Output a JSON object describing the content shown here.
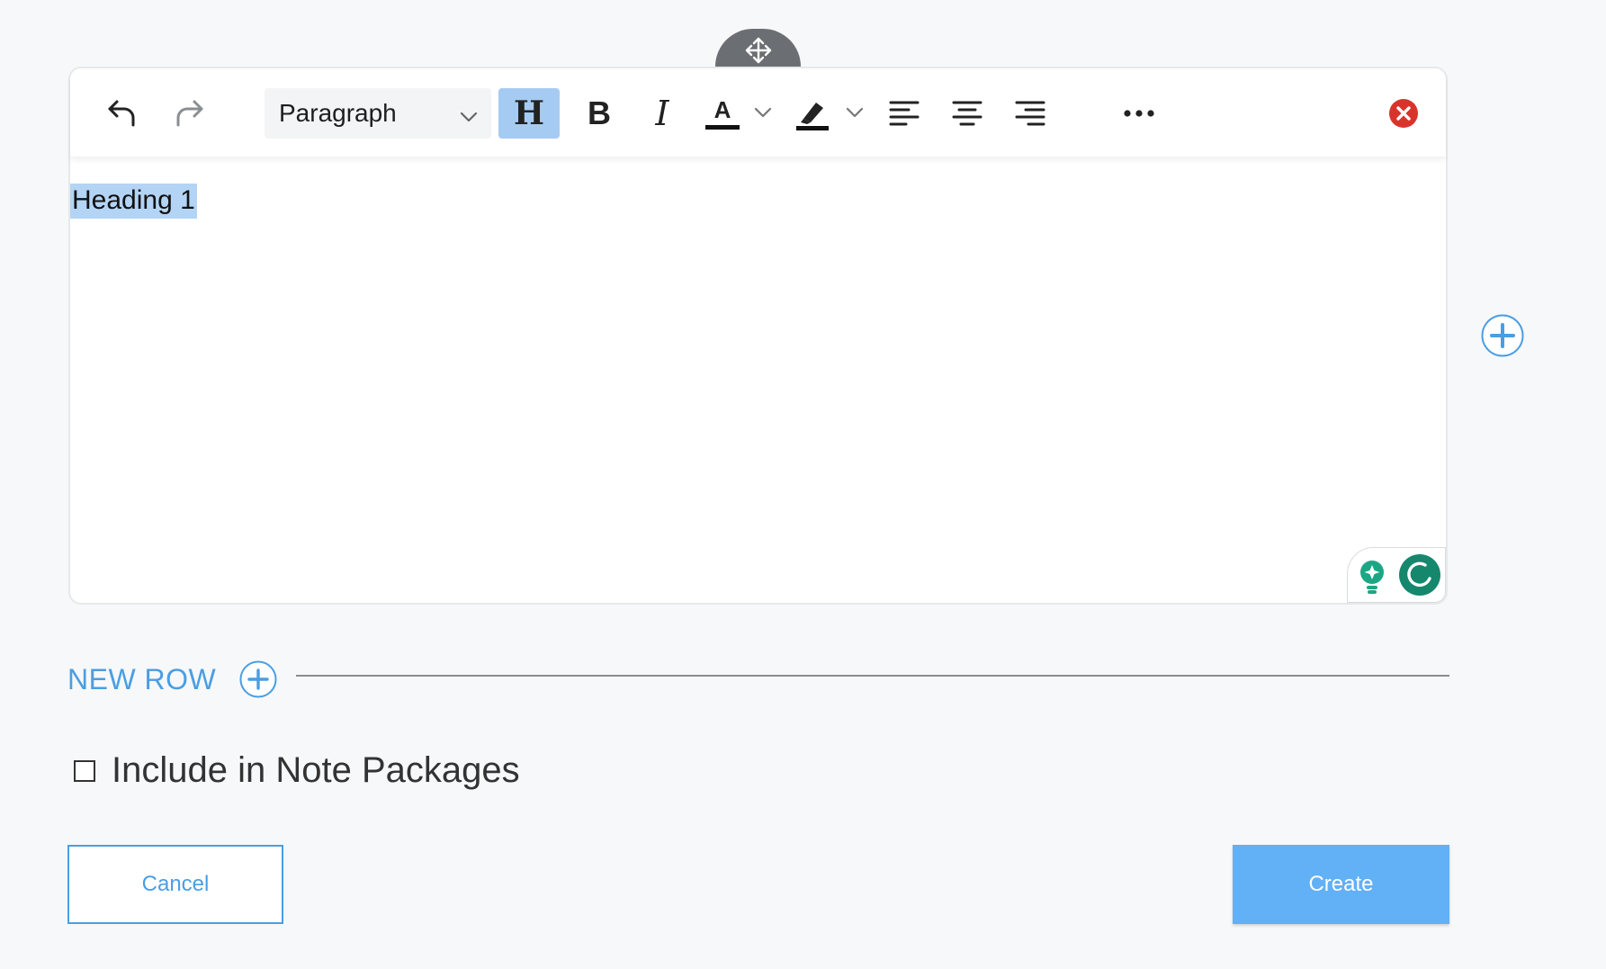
{
  "toolbar": {
    "block_format_selected": "Paragraph",
    "heading_label": "H",
    "bold_label": "B",
    "italic_label": "I",
    "font_color_label": "A"
  },
  "editor": {
    "content_text": "Heading 1"
  },
  "new_row": {
    "label": "NEW ROW"
  },
  "include": {
    "label": "Include in Note Packages",
    "checked": false
  },
  "actions": {
    "cancel_label": "Cancel",
    "create_label": "Create"
  },
  "colors": {
    "accent": "#4a9ee3",
    "primary_button": "#62b0f5",
    "heading_active": "#a6cbf2",
    "close_red": "#d9342b",
    "grammarly_green": "#15876d"
  },
  "icons": [
    "move-icon",
    "undo-icon",
    "redo-icon",
    "chevron-down-icon",
    "highlighter-icon",
    "align-left-icon",
    "align-center-icon",
    "align-right-icon",
    "more-icon",
    "close-icon",
    "lightbulb-icon",
    "grammarly-icon",
    "plus-circle-icon"
  ]
}
